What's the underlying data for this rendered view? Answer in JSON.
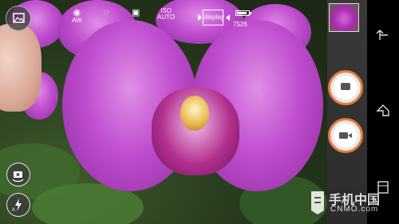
{
  "top_bar": {
    "awb_label": "AW",
    "iso_label_top": "ISO",
    "iso_label_bottom": "AUTO",
    "display_label": "display",
    "shots_remaining": "7526"
  },
  "watermark": {
    "chinese": "手机中国",
    "english": "CNMO.com"
  },
  "colors": {
    "shutter_ring": "#e77a3c",
    "panel_bg": "#2b2b2b",
    "nav_bg": "#000000"
  },
  "icons": {
    "gallery": "gallery-icon",
    "awb": "white-balance-icon",
    "exposure": "exposure-icon",
    "image_size": "image-icon",
    "iso": "iso-icon",
    "display": "display-icon",
    "battery": "battery-icon",
    "switch_camera": "switch-camera-icon",
    "flash": "flash-auto-icon",
    "photo_shutter": "camera-icon",
    "video_shutter": "video-camera-icon",
    "back": "back-icon",
    "home": "home-icon",
    "recents": "recents-icon"
  }
}
